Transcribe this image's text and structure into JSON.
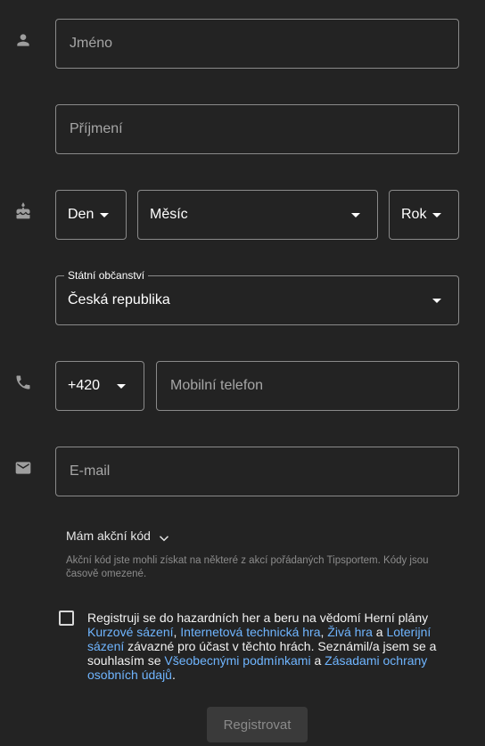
{
  "form": {
    "first_name": {
      "placeholder": "Jméno",
      "icon": "person-icon"
    },
    "last_name": {
      "placeholder": "Příjmení"
    },
    "birth": {
      "icon": "cake-icon",
      "day_label": "Den",
      "month_label": "Měsíc",
      "year_label": "Rok"
    },
    "citizenship": {
      "legend": "Státní občanství",
      "value": "Česká republika"
    },
    "phone": {
      "icon": "phone-icon",
      "prefix": "+420",
      "placeholder": "Mobilní telefon"
    },
    "email": {
      "icon": "mail-icon",
      "placeholder": "E-mail"
    },
    "promo": {
      "label": "Mám akční kód",
      "note": "Akční kód jste mohli získat na některé z akcí pořádaných Tipsportem. Kódy jsou časově omezené."
    },
    "consent": {
      "checked": false,
      "part1": "Registruji se do hazardních her a beru na vědomí Herní plány ",
      "link1": "Kurzové sázení",
      "sep1": ", ",
      "link2": "Internetová technická hra",
      "sep2": ", ",
      "link3": "Živá hra",
      "sep3": " a ",
      "link4": "Loterijní sázení",
      "part2": " závazné pro účast v těchto hrách. Seznámil/a jsem se a souhlasím se ",
      "link5": "Všeobecnými podmínkami",
      "sep4": " a ",
      "link6": "Zásadami ochrany osobních údajů",
      "end": "."
    },
    "submit_label": "Registrovat"
  }
}
